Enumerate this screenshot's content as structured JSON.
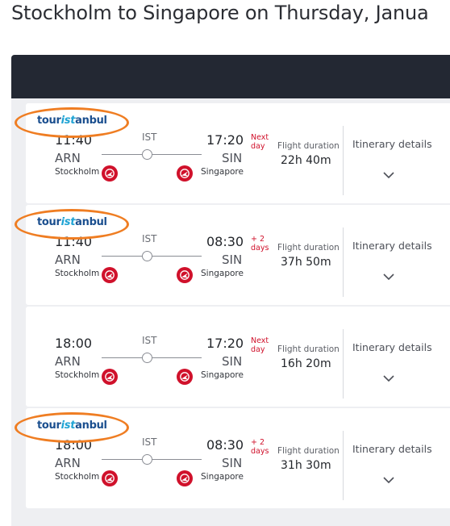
{
  "page": {
    "title": "Stockholm to Singapore on Thursday, Janua"
  },
  "brand": {
    "logo_parts": [
      "tour",
      "ist",
      "anbul"
    ],
    "accent_color": "#ef7d22",
    "airline_color": "#d0112b"
  },
  "flights": [
    {
      "dep_time": "11:40",
      "dep_code": "ARN",
      "dep_city": "Stockholm",
      "via": "IST",
      "arr_time": "17:20",
      "arr_code": "SIN",
      "arr_city": "Singapore",
      "day_note": [
        "Next",
        "day"
      ],
      "duration_label": "Flight duration",
      "duration": "22h 40m",
      "itinerary_label": "Itinerary details",
      "has_logo": true,
      "airline_icon": "turkish-airlines-logo-icon"
    },
    {
      "dep_time": "11:40",
      "dep_code": "ARN",
      "dep_city": "Stockholm",
      "via": "IST",
      "arr_time": "08:30",
      "arr_code": "SIN",
      "arr_city": "Singapore",
      "day_note": [
        "+ 2",
        "days"
      ],
      "duration_label": "Flight duration",
      "duration": "37h 50m",
      "itinerary_label": "Itinerary details",
      "has_logo": true,
      "airline_icon": "turkish-airlines-logo-icon"
    },
    {
      "dep_time": "18:00",
      "dep_code": "ARN",
      "dep_city": "Stockholm",
      "via": "IST",
      "arr_time": "17:20",
      "arr_code": "SIN",
      "arr_city": "Singapore",
      "day_note": [
        "Next",
        "day"
      ],
      "duration_label": "Flight duration",
      "duration": "16h 20m",
      "itinerary_label": "Itinerary details",
      "has_logo": false,
      "airline_icon": "turkish-airlines-logo-icon"
    },
    {
      "dep_time": "18:00",
      "dep_code": "ARN",
      "dep_city": "Stockholm",
      "via": "IST",
      "arr_time": "08:30",
      "arr_code": "SIN",
      "arr_city": "Singapore",
      "day_note": [
        "+ 2",
        "days"
      ],
      "duration_label": "Flight duration",
      "duration": "31h 30m",
      "itinerary_label": "Itinerary details",
      "has_logo": true,
      "airline_icon": "turkish-airlines-logo-icon"
    }
  ]
}
